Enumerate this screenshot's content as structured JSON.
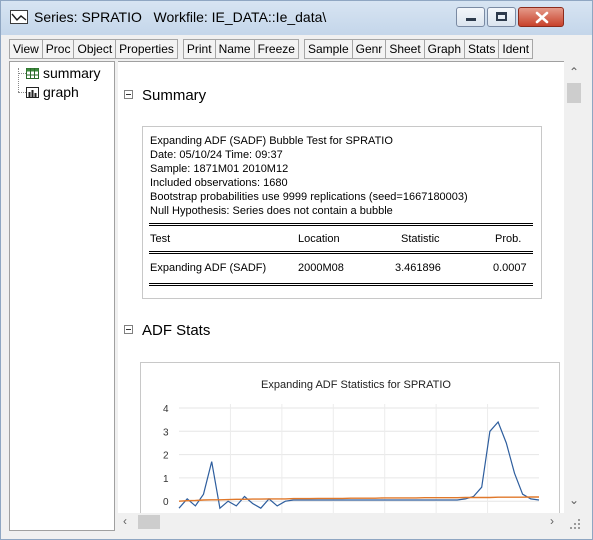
{
  "window": {
    "title": "Series: SPRATIO   Workfile: IE_DATA::Ie_data\\"
  },
  "toolbar": {
    "buttons": [
      "View",
      "Proc",
      "Object",
      "Properties",
      "Print",
      "Name",
      "Freeze",
      "Sample",
      "Genr",
      "Sheet",
      "Graph",
      "Stats",
      "Ident"
    ]
  },
  "tree": {
    "items": [
      {
        "label": "summary",
        "icon": "table-icon"
      },
      {
        "label": "graph",
        "icon": "graph-icon"
      }
    ]
  },
  "summary": {
    "heading": "Summary",
    "lines": [
      "Expanding ADF (SADF) Bubble Test for SPRATIO",
      "Date: 05/10/24   Time: 09:37",
      "Sample: 1871M01 2010M12",
      "Included observations: 1680",
      "Bootstrap probabilities use 9999 replications (seed=1667180003)",
      "Null Hypothesis: Series does not contain a bubble"
    ],
    "table": {
      "headers": [
        "Test",
        "Location",
        "Statistic",
        "Prob."
      ],
      "row": [
        "Expanding ADF (SADF)",
        "2000M08",
        "3.461896",
        "0.0007"
      ]
    }
  },
  "adf": {
    "heading": "ADF Stats"
  },
  "chart_data": {
    "type": "line",
    "title": "Expanding ADF Statistics for SPRATIO",
    "xlabel": "",
    "ylabel": "",
    "ylim": [
      -0.5,
      4
    ],
    "yticks": [
      "4",
      "3",
      "2",
      "1",
      "0"
    ],
    "series": [
      {
        "color": "#2e5e9e",
        "values": [
          -0.3,
          0.1,
          -0.2,
          0.3,
          1.7,
          -0.3,
          0.0,
          -0.2,
          0.2,
          -0.1,
          -0.3,
          0.1,
          -0.2,
          0.0,
          0.05,
          0.05,
          0.05,
          0.05,
          0.05,
          0.05,
          0.05,
          0.05,
          0.05,
          0.05,
          0.05,
          0.05,
          0.05,
          0.05,
          0.05,
          0.05,
          0.05,
          0.05,
          0.05,
          0.05,
          0.05,
          0.1,
          0.2,
          0.6,
          3.0,
          3.4,
          2.5,
          1.2,
          0.3,
          0.1,
          0.05
        ]
      },
      {
        "color": "#e0782a",
        "values": [
          0.0,
          0.02,
          0.03,
          0.05,
          0.06,
          0.06,
          0.07,
          0.08,
          0.08,
          0.09,
          0.09,
          0.1,
          0.1,
          0.1,
          0.11,
          0.11,
          0.11,
          0.12,
          0.12,
          0.12,
          0.12,
          0.13,
          0.13,
          0.13,
          0.13,
          0.14,
          0.14,
          0.14,
          0.14,
          0.14,
          0.15,
          0.15,
          0.15,
          0.15,
          0.15,
          0.16,
          0.16,
          0.16,
          0.16,
          0.17,
          0.17,
          0.17,
          0.17,
          0.18,
          0.18
        ]
      }
    ]
  }
}
